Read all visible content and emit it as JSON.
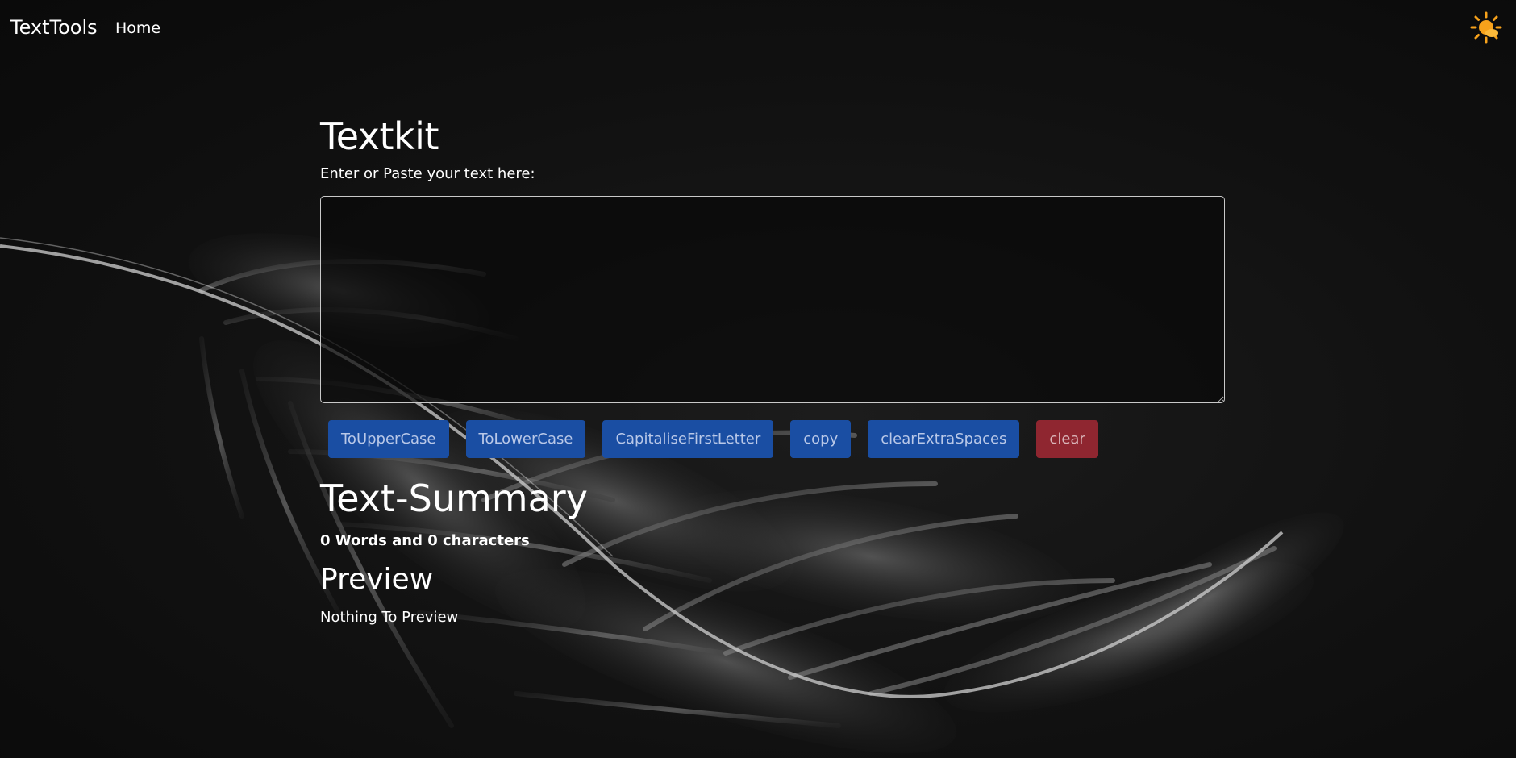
{
  "navbar": {
    "brand": "TextTools",
    "links": [
      "Home"
    ],
    "theme_toggle_icon": "sun-icon",
    "theme_toggle_color": "#f7a21b"
  },
  "main": {
    "title": "Textkit",
    "input_label": "Enter or Paste your text here:",
    "input_value": "",
    "input_placeholder": "",
    "buttons": [
      {
        "label": "ToUpperCase",
        "color": "#1a4ea3"
      },
      {
        "label": "ToLowerCase",
        "color": "#1a4ea3"
      },
      {
        "label": "CapitaliseFirstLetter",
        "color": "#1a4ea3"
      },
      {
        "label": "copy",
        "color": "#1a4ea3"
      },
      {
        "label": "clearExtraSpaces",
        "color": "#1a4ea3"
      },
      {
        "label": "clear",
        "color": "#8f2630"
      }
    ]
  },
  "summary": {
    "title": "Text-Summary",
    "stats": "0 Words and 0 characters"
  },
  "preview": {
    "title": "Preview",
    "text": "Nothing To Preview"
  },
  "background": {
    "image": "feather-illustration",
    "color": "#111111"
  }
}
